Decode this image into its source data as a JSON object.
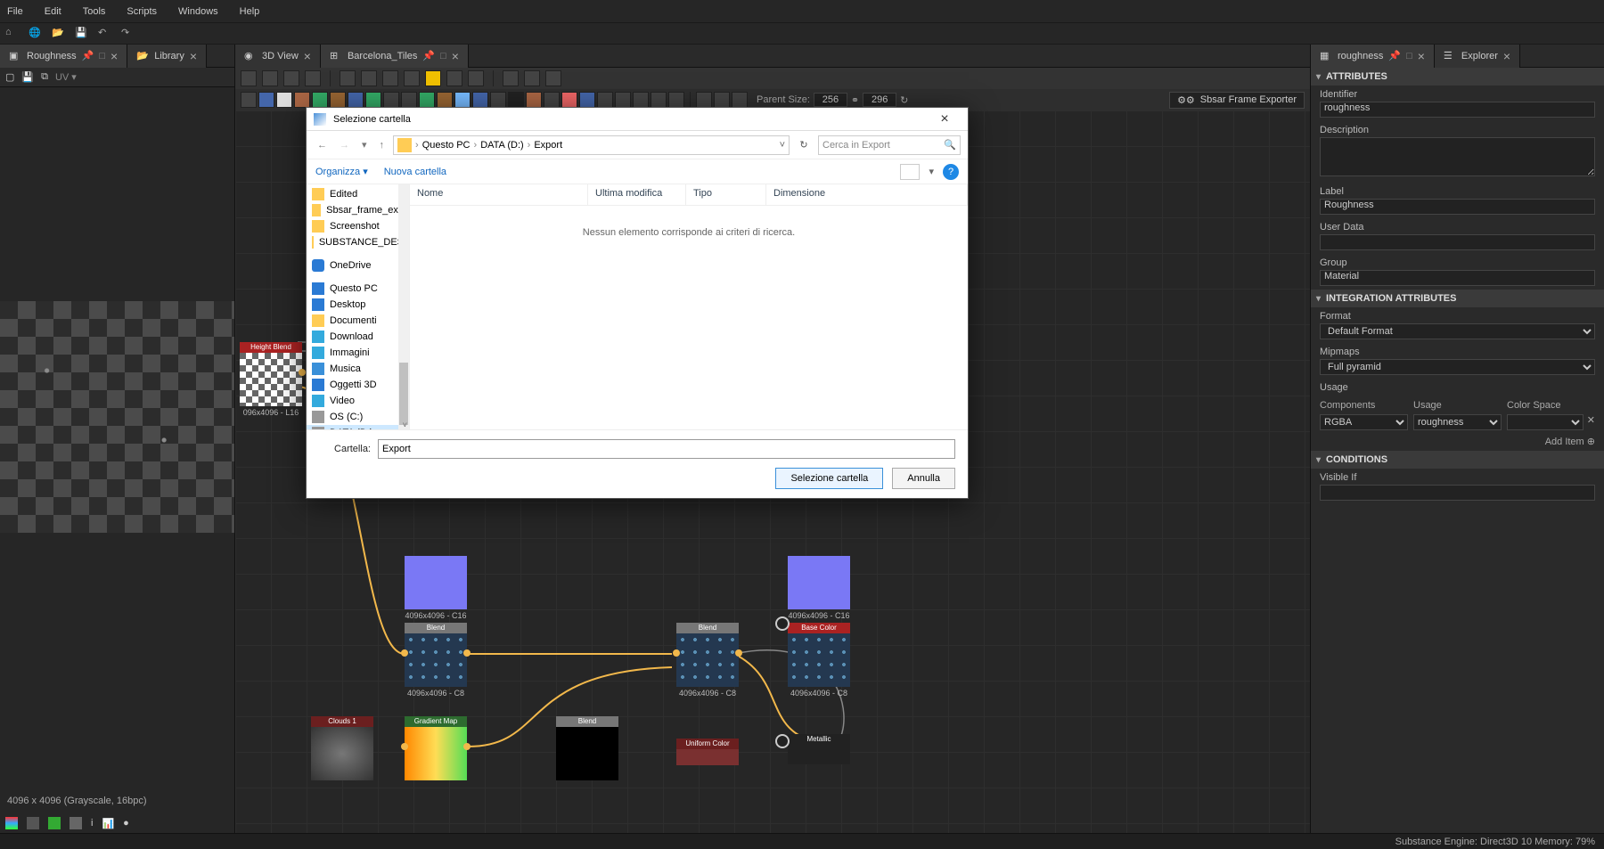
{
  "menubar": {
    "items": [
      "File",
      "Edit",
      "Tools",
      "Scripts",
      "Windows",
      "Help"
    ]
  },
  "panels": {
    "left": {
      "tabs": [
        {
          "label": "Roughness",
          "active": true
        },
        {
          "label": "Library",
          "active": false
        }
      ],
      "status": "4096 x 4096 (Grayscale, 16bpc)"
    },
    "center": {
      "tabs": [
        {
          "label": "3D View",
          "active": false
        },
        {
          "label": "Barcelona_Tiles",
          "active": true
        }
      ],
      "parent_size_label": "Parent Size:",
      "parent_w": "256",
      "parent_h": "296",
      "exporter": "Sbsar Frame Exporter"
    },
    "right": {
      "tabs": [
        {
          "label": "roughness",
          "active": true
        },
        {
          "label": "Explorer",
          "active": false
        }
      ],
      "attributes_header": "ATTRIBUTES",
      "identifier_label": "Identifier",
      "identifier": "roughness",
      "description_label": "Description",
      "description": "",
      "label_label": "Label",
      "label": "Roughness",
      "userdata_label": "User Data",
      "userdata": "",
      "group_label": "Group",
      "group": "Material",
      "integration_header": "INTEGRATION ATTRIBUTES",
      "format_label": "Format",
      "format": "Default Format",
      "mipmaps_label": "Mipmaps",
      "mipmaps": "Full pyramid",
      "usage_label": "Usage",
      "usage_cols": {
        "components": "Components",
        "usage": "Usage",
        "colorspace": "Color Space"
      },
      "usage_row": {
        "components": "RGBA",
        "usage": "roughness",
        "colorspace": ""
      },
      "additem": "Add Item",
      "conditions_header": "CONDITIONS",
      "visibleif_label": "Visible If",
      "visibleif": ""
    }
  },
  "graph": {
    "node_hb": {
      "title": "Height Blend",
      "cap": "096x4096 - L16"
    },
    "node_bl1": {
      "title": "Blend",
      "cap": "4096x4096 - C16"
    },
    "node_bl2": {
      "title": "Blend",
      "cap": "4096x4096 - C16"
    },
    "node_blA": {
      "title": "Blend",
      "cap": "4096x4096 - C8"
    },
    "node_blB": {
      "title": "Blend",
      "cap": "4096x4096 - C8"
    },
    "node_bc": {
      "title": "Base Color",
      "cap": "4096x4096 - C8"
    },
    "node_cl": {
      "title": "Clouds 1",
      "cap": ""
    },
    "node_gm": {
      "title": "Gradient Map",
      "cap": ""
    },
    "node_blk": {
      "title": "Blend",
      "cap": ""
    },
    "node_uc": {
      "title": "Uniform Color",
      "cap": ""
    },
    "node_mt": {
      "title": "Metallic",
      "cap": ""
    }
  },
  "dialog": {
    "title": "Selezione cartella",
    "breadcrumb": [
      "Questo PC",
      "DATA (D:)",
      "Export"
    ],
    "search_placeholder": "Cerca in Export",
    "organize": "Organizza",
    "newfolder": "Nuova cartella",
    "columns": {
      "name": "Nome",
      "modified": "Ultima modifica",
      "type": "Tipo",
      "size": "Dimensione"
    },
    "empty": "Nessun elemento corrisponde ai criteri di ricerca.",
    "tree": [
      {
        "icon": "folder",
        "label": "Edited"
      },
      {
        "icon": "folder",
        "label": "Sbsar_frame_exp"
      },
      {
        "icon": "folder",
        "label": "Screenshot"
      },
      {
        "icon": "folder",
        "label": "SUBSTANCE_DES"
      },
      {
        "icon": "cloud",
        "label": "OneDrive",
        "gap": true
      },
      {
        "icon": "pc",
        "label": "Questo PC",
        "gap": true
      },
      {
        "icon": "pc",
        "label": "Desktop"
      },
      {
        "icon": "folder",
        "label": "Documenti"
      },
      {
        "icon": "img",
        "label": "Download"
      },
      {
        "icon": "img",
        "label": "Immagini"
      },
      {
        "icon": "music",
        "label": "Musica"
      },
      {
        "icon": "pc",
        "label": "Oggetti 3D"
      },
      {
        "icon": "img",
        "label": "Video"
      },
      {
        "icon": "disk",
        "label": "OS (C:)"
      },
      {
        "icon": "disk",
        "label": "DATA (D:)",
        "selected": true
      }
    ],
    "folder_label": "Cartella:",
    "folder_value": "Export",
    "btn_select": "Selezione cartella",
    "btn_cancel": "Annulla"
  },
  "statusbar": {
    "engine": "Substance Engine: Direct3D 10  Memory: 79%"
  }
}
